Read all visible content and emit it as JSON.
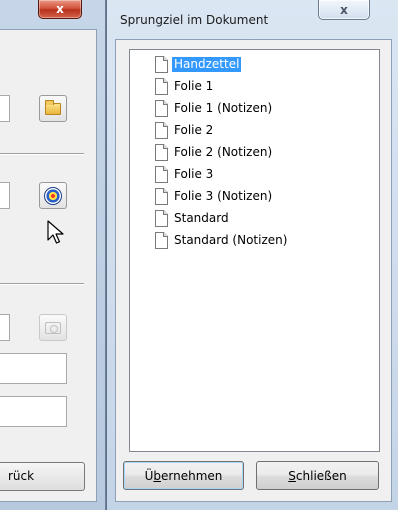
{
  "background_window": {
    "close_glyph": "x",
    "back_button_label": "rück"
  },
  "dialog": {
    "title": "Sprungziel im Dokument",
    "close_glyph": "x",
    "tree_items": [
      {
        "label": "Handzettel",
        "selected": true
      },
      {
        "label": "Folie 1",
        "selected": false
      },
      {
        "label": "Folie 1 (Notizen)",
        "selected": false
      },
      {
        "label": "Folie 2",
        "selected": false
      },
      {
        "label": "Folie 2 (Notizen)",
        "selected": false
      },
      {
        "label": "Folie 3",
        "selected": false
      },
      {
        "label": "Folie 3 (Notizen)",
        "selected": false
      },
      {
        "label": "Standard",
        "selected": false
      },
      {
        "label": "Standard (Notizen)",
        "selected": false
      }
    ],
    "buttons": {
      "apply": {
        "prefix": "Ü",
        "accel": "b",
        "rest": "ernehmen"
      },
      "close": {
        "prefix": "",
        "accel": "S",
        "rest": "chließen"
      }
    }
  },
  "icons": {
    "folder": "folder-icon",
    "target": "target-icon",
    "camera": "camera-icon",
    "document": "document-icon",
    "cursor": "mouse-cursor-icon"
  },
  "colors": {
    "selection": "#3399ff",
    "titlebar": "#c4d4e7",
    "close_red": "#c0392b"
  }
}
